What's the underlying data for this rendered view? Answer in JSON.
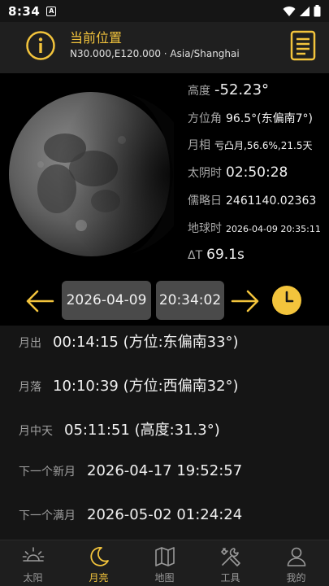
{
  "status": {
    "time": "8:34",
    "notif": "A"
  },
  "header": {
    "title": "当前位置",
    "location": "N30.000,E120.000 · Asia/Shanghai"
  },
  "info": {
    "altitude_label": "高度",
    "altitude": "-52.23°",
    "azimuth_label": "方位角",
    "azimuth": "96.5°(东偏南7°)",
    "phase_label": "月相",
    "phase": "亏凸月,56.6%,21.5天",
    "lunar_time_label": "太阴时",
    "lunar_time": "02:50:28",
    "julian_label": "儒略日",
    "julian": "2461140.02363",
    "earth_time_label": "地球时",
    "earth_time": "2026-04-09 20:35:11",
    "delta_t_label": "ΔT",
    "delta_t": "69.1s"
  },
  "datebar": {
    "date": "2026-04-09",
    "time": "20:34:02"
  },
  "events": [
    {
      "label": "月出",
      "value": "00:14:15 (方位:东偏南33°)"
    },
    {
      "label": "月落",
      "value": "10:10:39 (方位:西偏南32°)"
    },
    {
      "label": "月中天",
      "value": "05:11:51 (高度:31.3°)"
    },
    {
      "label": "下一个新月",
      "value": "2026-04-17 19:52:57"
    },
    {
      "label": "下一个满月",
      "value": "2026-05-02 01:24:24"
    }
  ],
  "nav": [
    {
      "label": "太阳",
      "icon": "sun-icon"
    },
    {
      "label": "月亮",
      "icon": "moon-icon"
    },
    {
      "label": "地图",
      "icon": "map-icon"
    },
    {
      "label": "工具",
      "icon": "tools-icon"
    },
    {
      "label": "我的",
      "icon": "user-icon"
    }
  ],
  "colors": {
    "accent": "#f3c43c",
    "background": "#151515",
    "panel": "#000000",
    "header": "#1f1f1f"
  }
}
